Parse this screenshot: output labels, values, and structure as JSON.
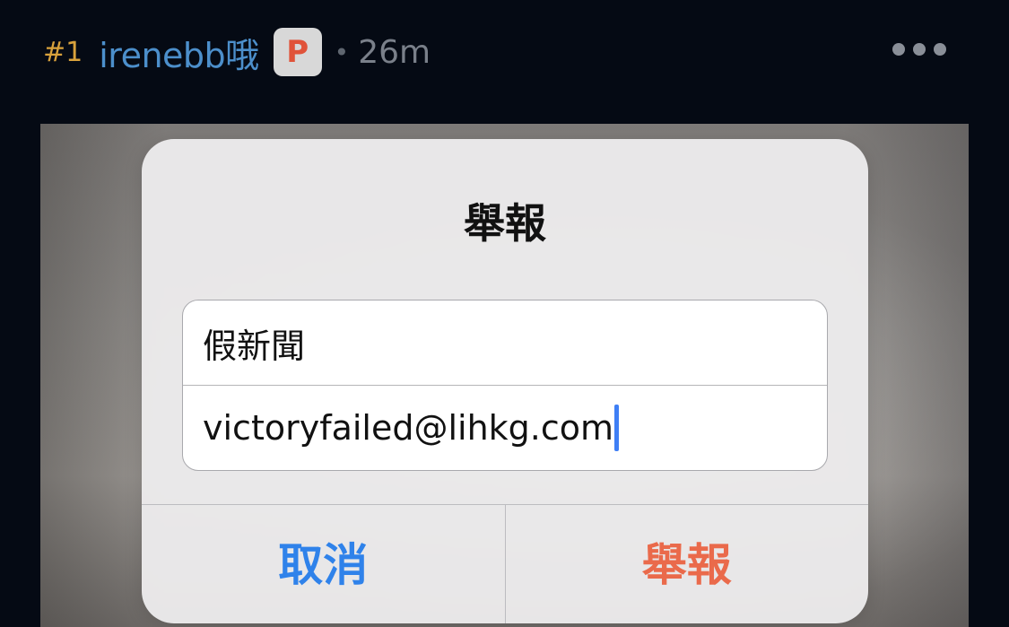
{
  "post": {
    "number": "#1",
    "username": "irenebb哦",
    "badge": "P",
    "separator": "•",
    "time": "26m"
  },
  "alert": {
    "title": "舉報",
    "fields": [
      {
        "value": "假新聞"
      },
      {
        "value": "victoryfailed@lihkg.com"
      }
    ],
    "cancel_label": "取消",
    "report_label": "舉報"
  },
  "icons": {
    "more": "more-horizontal-icon"
  },
  "colors": {
    "background": "#050a14",
    "post_number": "#d9a23c",
    "username": "#4c8fcb",
    "badge_letter": "#e0533a",
    "cancel": "#2f82ea",
    "report": "#ea6a4b",
    "caret": "#3f7ff5"
  }
}
